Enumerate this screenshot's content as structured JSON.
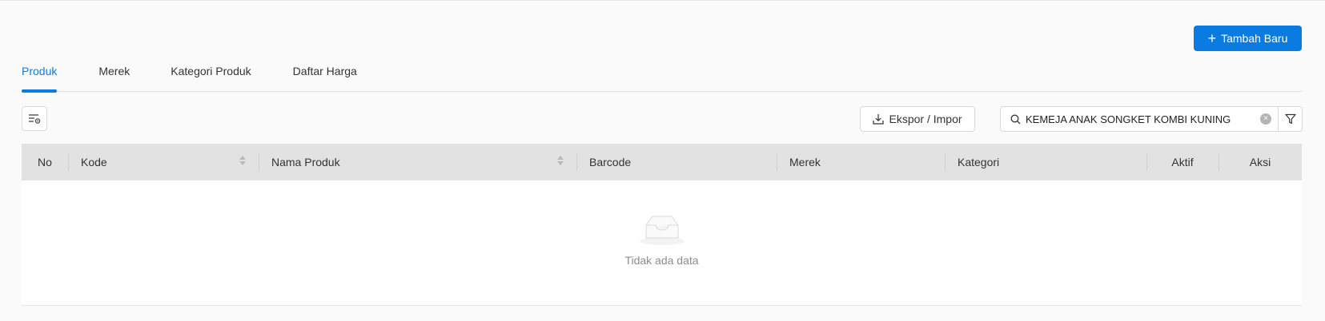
{
  "header": {
    "add_button_label": "Tambah Baru",
    "add_button_icon": "plus-icon"
  },
  "tabs": [
    {
      "label": "Produk",
      "active": true
    },
    {
      "label": "Merek",
      "active": false
    },
    {
      "label": "Kategori Produk",
      "active": false
    },
    {
      "label": "Daftar Harga",
      "active": false
    }
  ],
  "toolbar": {
    "column_settings_icon": "column-settings-icon",
    "export_label": "Ekspor / Impor",
    "export_icon": "download-icon",
    "search_value": "KEMEJA ANAK SONGKET KOMBI KUNING",
    "search_icon": "search-icon",
    "clear_icon": "clear-icon",
    "filter_icon": "filter-icon"
  },
  "table": {
    "columns": [
      {
        "label": "No",
        "sortable": false
      },
      {
        "label": "Kode",
        "sortable": true
      },
      {
        "label": "Nama Produk",
        "sortable": true
      },
      {
        "label": "Barcode",
        "sortable": false
      },
      {
        "label": "Merek",
        "sortable": false
      },
      {
        "label": "Kategori",
        "sortable": false
      },
      {
        "label": "Aktif",
        "sortable": false
      },
      {
        "label": "Aksi",
        "sortable": false
      }
    ],
    "rows": [],
    "empty_text": "Tidak ada data",
    "empty_icon": "empty-inbox-icon"
  },
  "colors": {
    "primary": "#0a7be0",
    "header_bg": "#e2e2e2",
    "page_bg": "#fafafa"
  }
}
